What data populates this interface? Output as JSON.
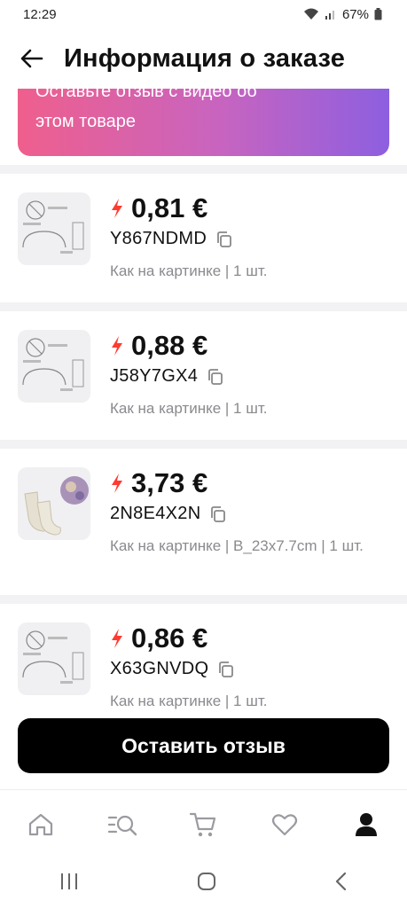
{
  "status_bar": {
    "time": "12:29",
    "battery": "67%"
  },
  "header": {
    "title": "Информация о заказе"
  },
  "banner": {
    "line1": "Оставьте отзыв с видео об",
    "line2": "этом товаре"
  },
  "items": [
    {
      "price": "0,81 €",
      "code": "Y867NDMD",
      "variant": "Как на картинке | 1 шт."
    },
    {
      "price": "0,88 €",
      "code": "J58Y7GX4",
      "variant": "Как на картинке | 1 шт."
    },
    {
      "price": "3,73 €",
      "code": "2N8E4X2N",
      "variant": "Как на картинке | B_23x7.7cm | 1 шт."
    },
    {
      "price": "0,86 €",
      "code": "X63GNVDQ",
      "variant": "Как на картинке | 1 шт."
    }
  ],
  "cta": {
    "label": "Оставить отзыв"
  },
  "bottom_nav": [
    "home-icon",
    "catalog-search-icon",
    "cart-icon",
    "heart-icon",
    "profile-icon"
  ],
  "colors": {
    "accent_red": "#ff3b30",
    "banner_start": "#ef5f8d",
    "banner_end": "#8d5fe0"
  }
}
